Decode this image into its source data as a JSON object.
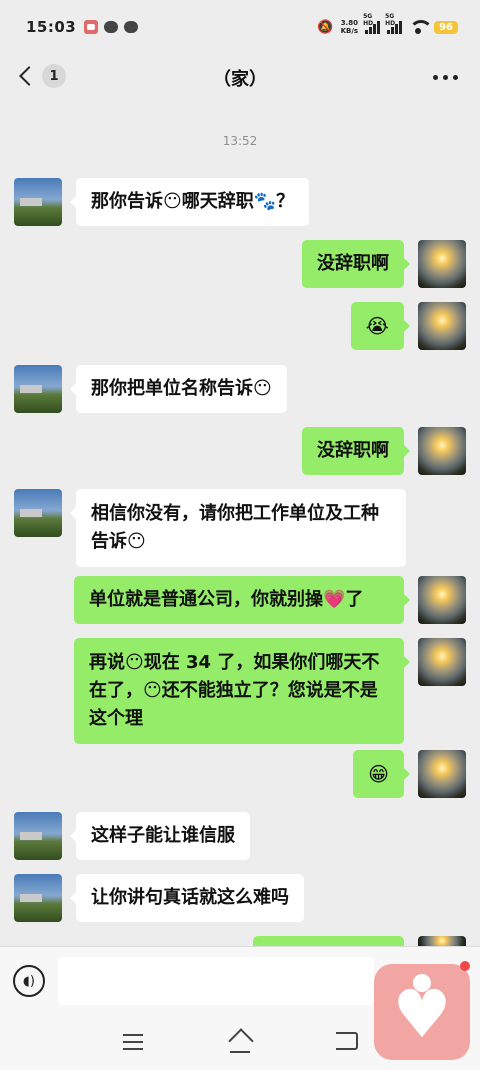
{
  "status_bar": {
    "time": "15:03",
    "net_speed_value": "3.80",
    "net_speed_unit": "KB/s",
    "sim1_label": "5G HD",
    "sim2_label": "5G HD",
    "battery": "96",
    "battery_color": "#f5c43a"
  },
  "header": {
    "back_badge": "1",
    "title": "（家）"
  },
  "timestamp": "13:52",
  "messages": [
    {
      "side": "left",
      "text": "那你告诉😶哪天辞职🐾？"
    },
    {
      "side": "right",
      "text": "没辞职啊"
    },
    {
      "side": "right",
      "text": "😭"
    },
    {
      "side": "left",
      "text": "那你把单位名称告诉😶"
    },
    {
      "side": "right",
      "text": "没辞职啊"
    },
    {
      "side": "left",
      "text": "相信你没有，请你把工作单位及工种告诉😶"
    },
    {
      "side": "right",
      "text": "单位就是普通公司，你就别操💗了"
    },
    {
      "side": "right",
      "text": "再说😶现在 34 了，如果你们哪天不在了，😶还不能独立了？您说是不是这个理"
    },
    {
      "side": "right",
      "text": "😁"
    },
    {
      "side": "left",
      "text": "这样子能让谁信服"
    },
    {
      "side": "left",
      "text": "让你讲句真话就这么难吗"
    }
  ],
  "input": {
    "placeholder": ""
  },
  "colors": {
    "bubble_sent": "#95ec69",
    "bubble_received": "#ffffff",
    "background": "#ededed",
    "floating_widget": "#f2a6a4"
  }
}
